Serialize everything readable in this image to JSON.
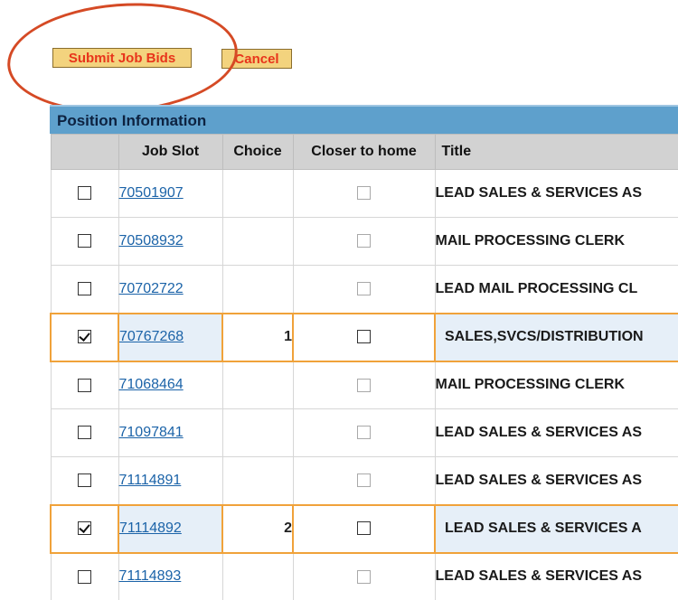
{
  "actions": {
    "submit_label": "Submit Job Bids",
    "cancel_label": "Cancel"
  },
  "section": {
    "title": "Position Information"
  },
  "table": {
    "columns": [
      "",
      "Job Slot",
      "Choice",
      "Closer to home",
      "Title"
    ],
    "rows": [
      {
        "selected": false,
        "job_slot": "70501907",
        "choice": "",
        "closer_to_home": false,
        "title": "LEAD SALES & SERVICES AS"
      },
      {
        "selected": false,
        "job_slot": "70508932",
        "choice": "",
        "closer_to_home": false,
        "title": "MAIL PROCESSING CLERK"
      },
      {
        "selected": false,
        "job_slot": "70702722",
        "choice": "",
        "closer_to_home": false,
        "title": "LEAD MAIL PROCESSING CL"
      },
      {
        "selected": true,
        "job_slot": "70767268",
        "choice": "1",
        "closer_to_home": false,
        "title": "SALES,SVCS/DISTRIBUTION"
      },
      {
        "selected": false,
        "job_slot": "71068464",
        "choice": "",
        "closer_to_home": false,
        "title": "MAIL PROCESSING CLERK"
      },
      {
        "selected": false,
        "job_slot": "71097841",
        "choice": "",
        "closer_to_home": false,
        "title": "LEAD SALES & SERVICES AS"
      },
      {
        "selected": false,
        "job_slot": "71114891",
        "choice": "",
        "closer_to_home": false,
        "title": "LEAD SALES & SERVICES AS"
      },
      {
        "selected": true,
        "job_slot": "71114892",
        "choice": "2",
        "closer_to_home": false,
        "title": "LEAD SALES & SERVICES A"
      },
      {
        "selected": false,
        "job_slot": "71114893",
        "choice": "",
        "closer_to_home": false,
        "title": "LEAD SALES & SERVICES AS"
      }
    ]
  },
  "colors": {
    "button_bg": "#f3d37e",
    "button_text": "#e8341b",
    "annotation_circle": "#d54a25",
    "section_header_bg": "#5ea0cc",
    "column_header_bg": "#d2d2d2",
    "selected_row_border": "#f0a23a",
    "link": "#1b63a8"
  }
}
